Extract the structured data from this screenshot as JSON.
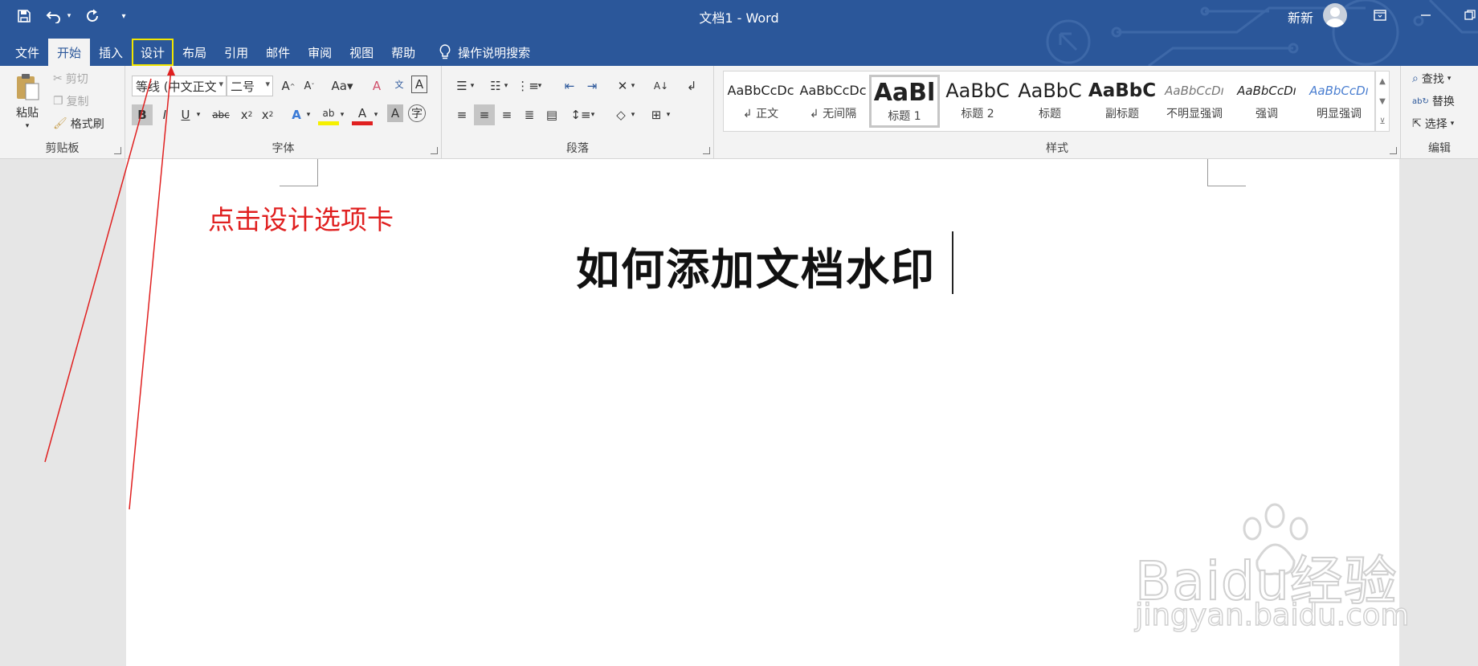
{
  "app": {
    "window_title": "文档1  -  Word",
    "user_name": "新新"
  },
  "tabs": [
    {
      "label": "文件"
    },
    {
      "label": "开始"
    },
    {
      "label": "插入"
    },
    {
      "label": "设计"
    },
    {
      "label": "布局"
    },
    {
      "label": "引用"
    },
    {
      "label": "邮件"
    },
    {
      "label": "审阅"
    },
    {
      "label": "视图"
    },
    {
      "label": "帮助"
    }
  ],
  "tell_me": "操作说明搜索",
  "clipboard": {
    "paste": "粘贴",
    "cut": "剪切",
    "copy": "复制",
    "format_painter": "格式刷",
    "label": "剪贴板"
  },
  "font": {
    "name": "等线 (中文正文",
    "size": "二号",
    "label": "字体"
  },
  "paragraph": {
    "label": "段落"
  },
  "styles": {
    "label": "样式",
    "items": [
      {
        "sample": "AaBbCcDc",
        "name": "正文"
      },
      {
        "sample": "AaBbCcDc",
        "name": "无间隔"
      },
      {
        "sample": "AaBl",
        "name": "标题 1"
      },
      {
        "sample": "AaBbC",
        "name": "标题 2"
      },
      {
        "sample": "AaBbC",
        "name": "标题"
      },
      {
        "sample": "AaBbC",
        "name": "副标题"
      },
      {
        "sample": "AaBbCcDı",
        "name": "不明显强调"
      },
      {
        "sample": "AaBbCcDı",
        "name": "强调"
      },
      {
        "sample": "AaBbCcDı",
        "name": "明显强调"
      }
    ]
  },
  "editing": {
    "find": "查找",
    "replace": "替换",
    "select": "选择",
    "label": "编辑"
  },
  "document": {
    "title": "如何添加文档水印",
    "annotation": "点击设计选项卡"
  },
  "watermark": {
    "line1": "Baidu经验",
    "line2": "jingyan.baidu.com"
  },
  "colors": {
    "ribbon_blue": "#2b579a",
    "annotation_red": "#e02020",
    "highlight_yellow": "#f2e600"
  }
}
